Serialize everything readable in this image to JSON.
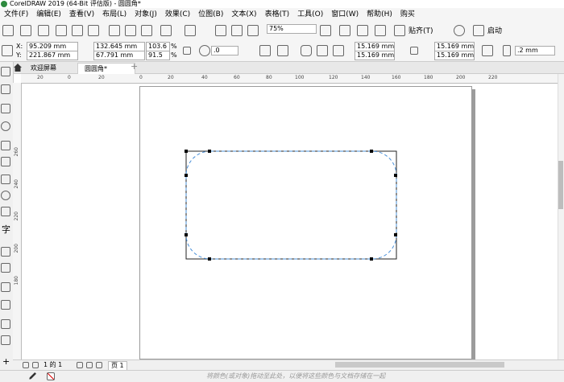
{
  "window": {
    "title": "CorelDRAW 2019 (64-Bit 评估版) - 圆圆角*"
  },
  "menu": [
    "文件(F)",
    "编辑(E)",
    "查看(V)",
    "布局(L)",
    "对象(J)",
    "效果(C)",
    "位图(B)",
    "文本(X)",
    "表格(T)",
    "工具(O)",
    "窗口(W)",
    "帮助(H)",
    "购买"
  ],
  "toolbar": {
    "zoom": "75%",
    "snap_label": "贴齐(T)",
    "launch_label": "启动"
  },
  "property_bar": {
    "x_label": "X:",
    "x_value": "95.209 mm",
    "y_label": "Y:",
    "y_value": "221.867 mm",
    "width_value": "132.645 mm",
    "height_value": "67.791 mm",
    "scale_x": "103.6",
    "scale_y": "91.5",
    "percent": "%",
    "rotation": ".0",
    "corner_tl": "15.169 mm",
    "corner_bl": "15.169 mm",
    "corner_tr": "15.169 mm",
    "corner_br": "15.169 mm",
    "outline_width": ".2 mm"
  },
  "tabs": [
    {
      "label": "欢迎屏幕"
    },
    {
      "label": "圆圆角*"
    }
  ],
  "ruler": {
    "ticks": [
      "20",
      "0",
      "20",
      "40",
      "60",
      "80",
      "100",
      "120",
      "140",
      "160",
      "180",
      "200",
      "220"
    ],
    "vticks": [
      "260",
      "240",
      "220",
      "200",
      "180"
    ]
  },
  "toolbox_text": "字",
  "page_nav": {
    "position": "1 的 1",
    "page_tab": "页 1"
  },
  "status": {
    "hint": "将颜色(或对象)拖动至此处，以便将这些颜色与文档存储在一起"
  }
}
